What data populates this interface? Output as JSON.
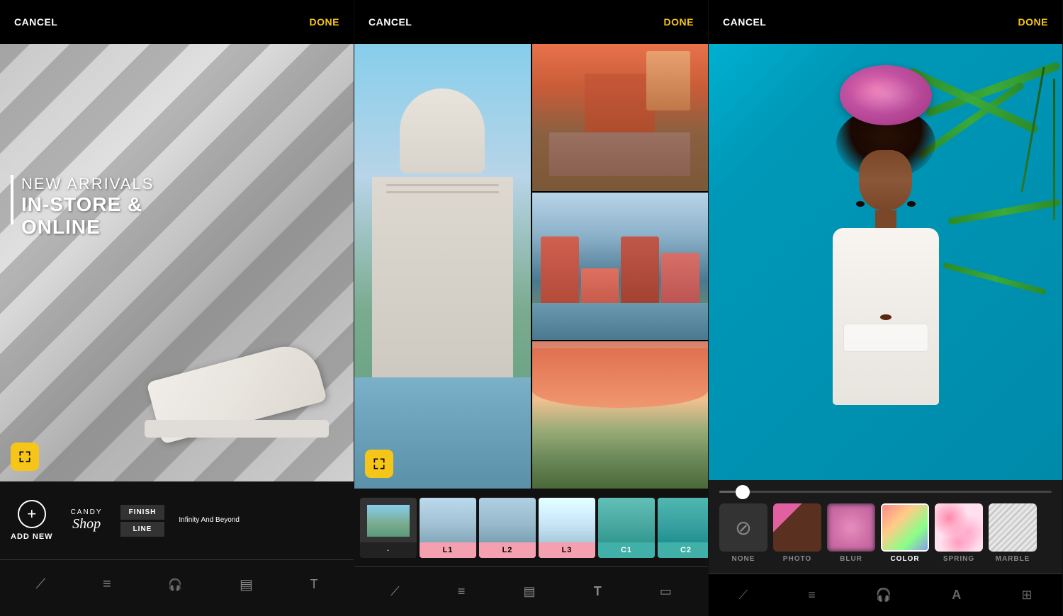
{
  "panel1": {
    "cancel": "CANCEL",
    "done": "DONE",
    "text_line1": "NEW ARRIVALS",
    "text_line2": "IN-STORE &",
    "text_line3": "ONLINE",
    "add_new_label": "ADD NEW",
    "candy_label": "CANDY",
    "shop_label": "Shop",
    "finish_label": "FINISH",
    "line_label": "LINE",
    "infinity_label": "Infinity And Beyond"
  },
  "panel2": {
    "cancel": "CANCEL",
    "done": "DONE",
    "filters": [
      {
        "id": "minus",
        "label": "-",
        "active": false
      },
      {
        "id": "l1",
        "label": "L1",
        "active": true
      },
      {
        "id": "l2",
        "label": "L2",
        "active": true
      },
      {
        "id": "l3",
        "label": "L3",
        "active": true
      },
      {
        "id": "c1",
        "label": "C1",
        "active": true
      },
      {
        "id": "c2",
        "label": "C2",
        "active": true
      }
    ]
  },
  "panel3": {
    "cancel": "CANCEL",
    "done": "DONE",
    "bg_options": [
      {
        "id": "none",
        "label": "NONE",
        "active": false
      },
      {
        "id": "photo",
        "label": "PHOTO",
        "active": false
      },
      {
        "id": "blur",
        "label": "BLUR",
        "active": false
      },
      {
        "id": "color",
        "label": "COLOR",
        "active": true
      },
      {
        "id": "spring",
        "label": "SPRING",
        "active": false
      },
      {
        "id": "marble",
        "label": "MARBLE",
        "active": false
      }
    ]
  }
}
